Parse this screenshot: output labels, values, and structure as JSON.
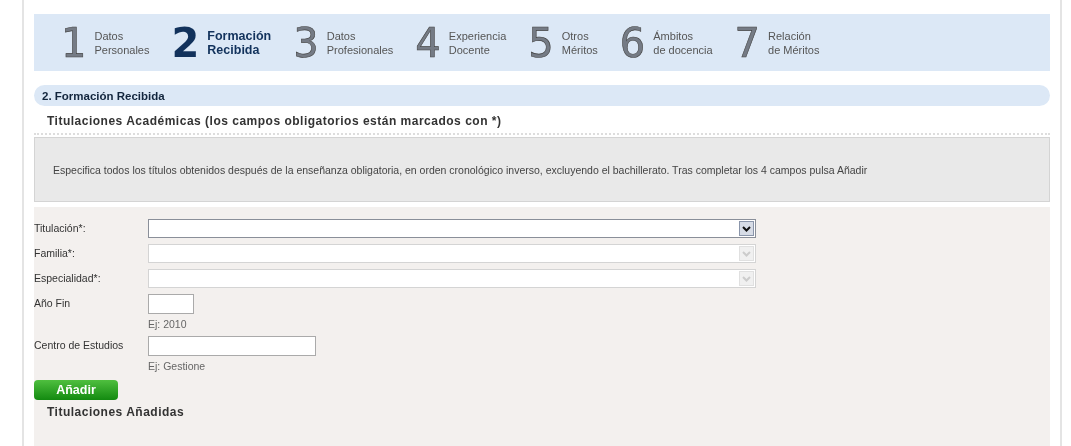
{
  "steps": [
    {
      "number": "1",
      "line1": "Datos",
      "line2": "Personales",
      "selected": false
    },
    {
      "number": "2",
      "line1": "Formación",
      "line2": "Recibida",
      "selected": true
    },
    {
      "number": "3",
      "line1": "Datos",
      "line2": "Profesionales",
      "selected": false
    },
    {
      "number": "4",
      "line1": "Experiencia",
      "line2": "Docente",
      "selected": false
    },
    {
      "number": "5",
      "line1": "Otros",
      "line2": "Méritos",
      "selected": false
    },
    {
      "number": "6",
      "line1": "Ámbitos",
      "line2": "de docencia",
      "selected": false
    },
    {
      "number": "7",
      "line1": "Relación",
      "line2": "de Méritos",
      "selected": false
    }
  ],
  "section_title": "2. Formación Recibida",
  "subtitle": "Titulaciones Académicas (los campos obligatorios están marcados con *)",
  "info": "Especifica todos los títulos obtenidos después de la enseñanza obligatoria, en orden cronológico inverso, excluyendo el bachillerato. Tras completar los 4 campos pulsa Añadir",
  "fields": [
    {
      "label": "Titulación*:",
      "kind": "select",
      "disabled": false
    },
    {
      "label": "Familia*:",
      "kind": "select",
      "disabled": true
    },
    {
      "label": "Especialidad*:",
      "kind": "select",
      "disabled": true
    },
    {
      "label": "Año Fin",
      "kind": "short",
      "hint": "Ej: 2010"
    },
    {
      "label": "Centro de Estudios",
      "kind": "medium",
      "hint": "Ej: Gestione"
    }
  ],
  "add_button": "Añadir",
  "added_title": "Titulaciones Añadidas"
}
